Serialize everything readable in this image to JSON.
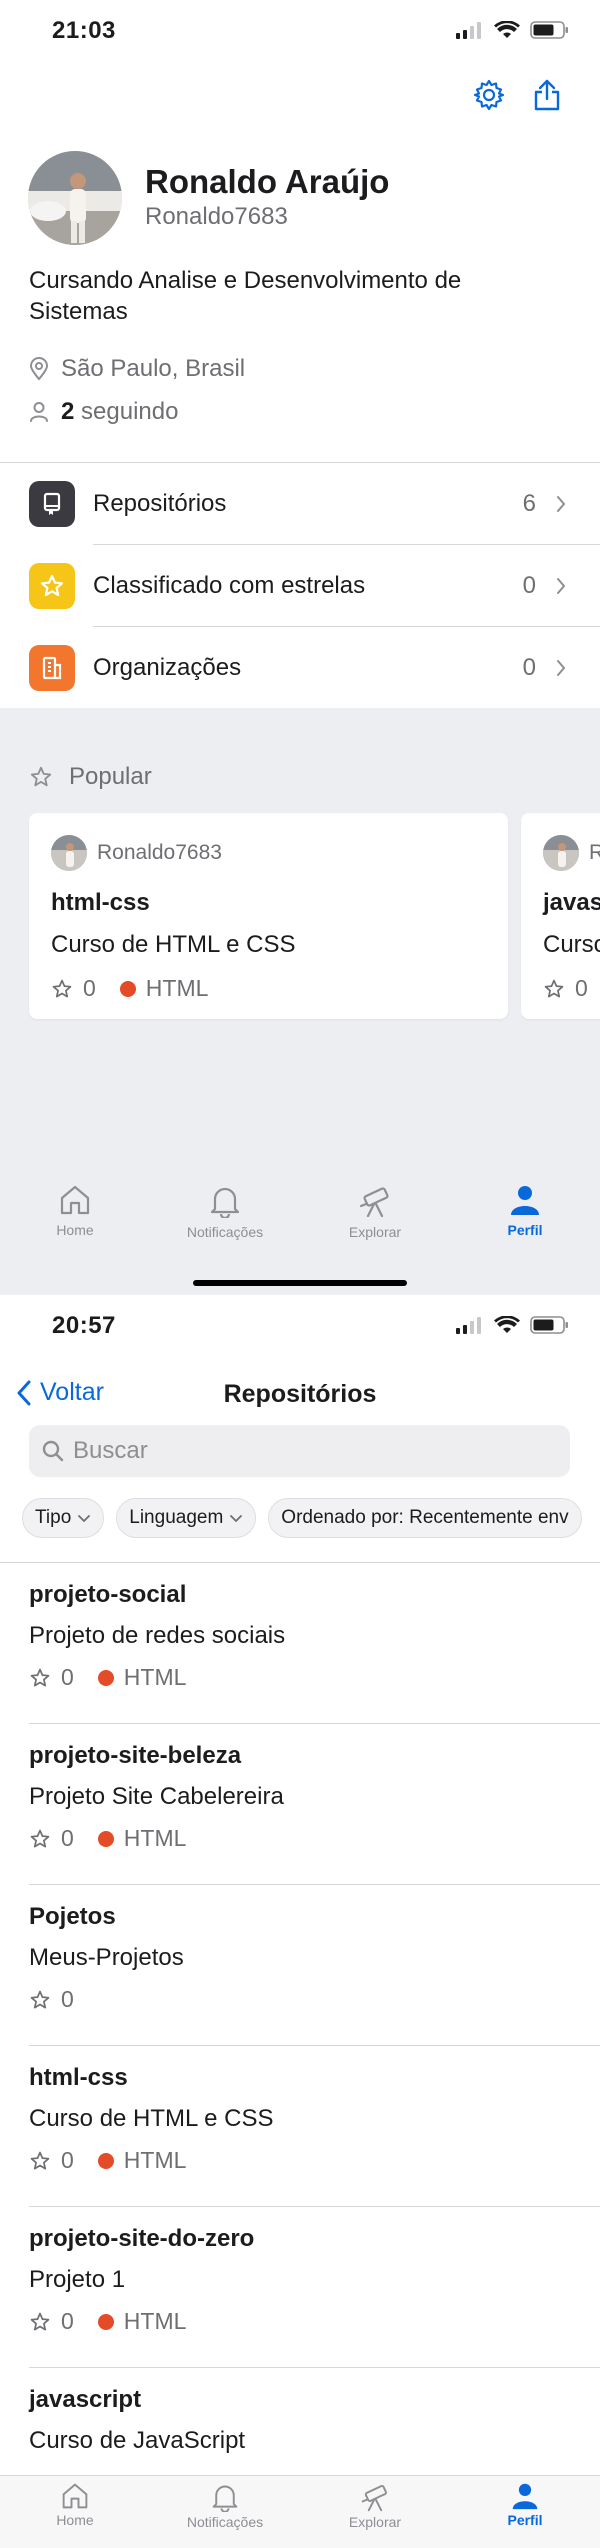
{
  "profile_screen": {
    "status_time": "21:03",
    "name": "Ronaldo Araújo",
    "login": "Ronaldo7683",
    "bio": "Cursando Analise e Desenvolvimento de Sistemas",
    "location": "São Paulo, Brasil",
    "following_count": "2",
    "following_label": "seguindo",
    "menu": [
      {
        "label": "Repositórios",
        "count": "6",
        "icon": "repo-icon",
        "color": "#3a3a40"
      },
      {
        "label": "Classificado com estrelas",
        "count": "0",
        "icon": "star-icon",
        "color": "#f5c518"
      },
      {
        "label": "Organizações",
        "count": "0",
        "icon": "organization-icon",
        "color": "#f2762e"
      }
    ],
    "popular_title": "Popular",
    "popular_cards": [
      {
        "owner": "Ronaldo7683",
        "name": "html-css",
        "description": "Curso de HTML e CSS",
        "stars": "0",
        "language": "HTML",
        "language_color": "#e34c26"
      },
      {
        "owner": "R",
        "name": "javas",
        "description": "Curso",
        "stars": "0"
      }
    ]
  },
  "tabbar": {
    "tabs": [
      {
        "label": "Home",
        "icon": "home-icon"
      },
      {
        "label": "Notificações",
        "icon": "bell-icon"
      },
      {
        "label": "Explorar",
        "icon": "telescope-icon"
      },
      {
        "label": "Perfil",
        "icon": "person-icon"
      }
    ],
    "active_color": "#0969da",
    "inactive_color": "#8e8e93"
  },
  "repos_screen": {
    "status_time": "20:57",
    "back_label": "Voltar",
    "title": "Repositórios",
    "search_placeholder": "Buscar",
    "filters": [
      "Tipo",
      "Linguagem",
      "Ordenado por: Recentemente env"
    ],
    "repos": [
      {
        "name": "projeto-social",
        "description": "Projeto de redes sociais",
        "stars": "0",
        "language": "HTML"
      },
      {
        "name": "projeto-site-beleza",
        "description": "Projeto Site Cabelereira",
        "stars": "0",
        "language": "HTML"
      },
      {
        "name": "Pojetos",
        "description": "Meus-Projetos",
        "stars": "0",
        "language": ""
      },
      {
        "name": "html-css",
        "description": "Curso de HTML e CSS",
        "stars": "0",
        "language": "HTML"
      },
      {
        "name": "projeto-site-do-zero",
        "description": "Projeto 1",
        "stars": "0",
        "language": "HTML"
      },
      {
        "name": "javascript",
        "description": "Curso de JavaScript",
        "stars": "",
        "language": ""
      }
    ],
    "language_color": "#e34c26"
  }
}
